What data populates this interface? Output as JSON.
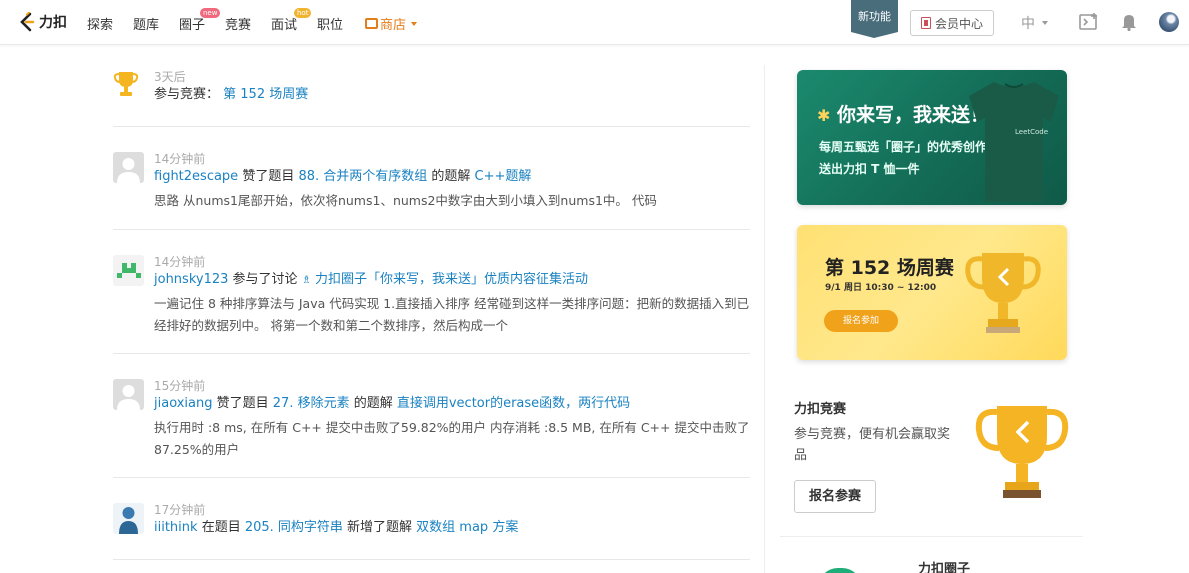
{
  "nav": {
    "logo_text": "力扣",
    "items": [
      "探索",
      "题库",
      "圈子",
      "竞赛",
      "面试",
      "职位"
    ],
    "badge_new": "new",
    "badge_hot": "hot",
    "store_label": "商店",
    "new_feature": "新功能",
    "member_center": "会员中心",
    "lang": "中"
  },
  "feed": [
    {
      "time": "3天后",
      "prefix": "参与竞赛：",
      "link": "第 152 场周赛"
    },
    {
      "time": "14分钟前",
      "user": "fight2escape",
      "action1": " 赞了题目 ",
      "problem": "88. 合并两个有序数组",
      "action2": " 的题解 ",
      "solution": "C++题解",
      "desc": "思路 从nums1尾部开始，依次将nums1、nums2中数字由大到小填入到nums1中。 代码"
    },
    {
      "time": "14分钟前",
      "user": "johnsky123",
      "action1": " 参与了讨论 ",
      "topic": "力扣圈子「你来写，我来送」优质内容征集活动",
      "desc": "一遍记住 8 种排序算法与 Java 代码实现 1.直接插入排序 经常碰到这样一类排序问题：把新的数据插入到已经排好的数据列中。 将第一个数和第二个数排序，然后构成一个"
    },
    {
      "time": "15分钟前",
      "user": "jiaoxiang",
      "action1": " 赞了题目 ",
      "problem": "27. 移除元素",
      "action2": " 的题解 ",
      "solution": "直接调用vector的erase函数，两行代码",
      "desc": "执行用时 :8 ms, 在所有 C++ 提交中击败了59.82%的用户 内存消耗 :8.5 MB, 在所有 C++ 提交中击败了87.25%的用户"
    },
    {
      "time": "17分钟前",
      "user": "iiithink",
      "action1": " 在题目 ",
      "problem": "205. 同构字符串",
      "action2": " 新增了题解 ",
      "solution": "双数组 map 方案"
    }
  ],
  "sidebar": {
    "banner1": {
      "title": "你来写，我来送！",
      "line1": "每周五甄选「圈子」的优秀创作者",
      "line2": "送出力扣 T 恤一件",
      "shirt_logo": "LeetCode"
    },
    "banner2": {
      "title": "第 152 场周赛",
      "date": "9/1 周日 10:30 ~ 12:00",
      "button": "报名参加"
    },
    "contest": {
      "title": "力扣竞赛",
      "desc": "参与竞赛，便有机会赢取奖品",
      "button": "报名参赛"
    },
    "circle_title": "力扣圈子"
  }
}
